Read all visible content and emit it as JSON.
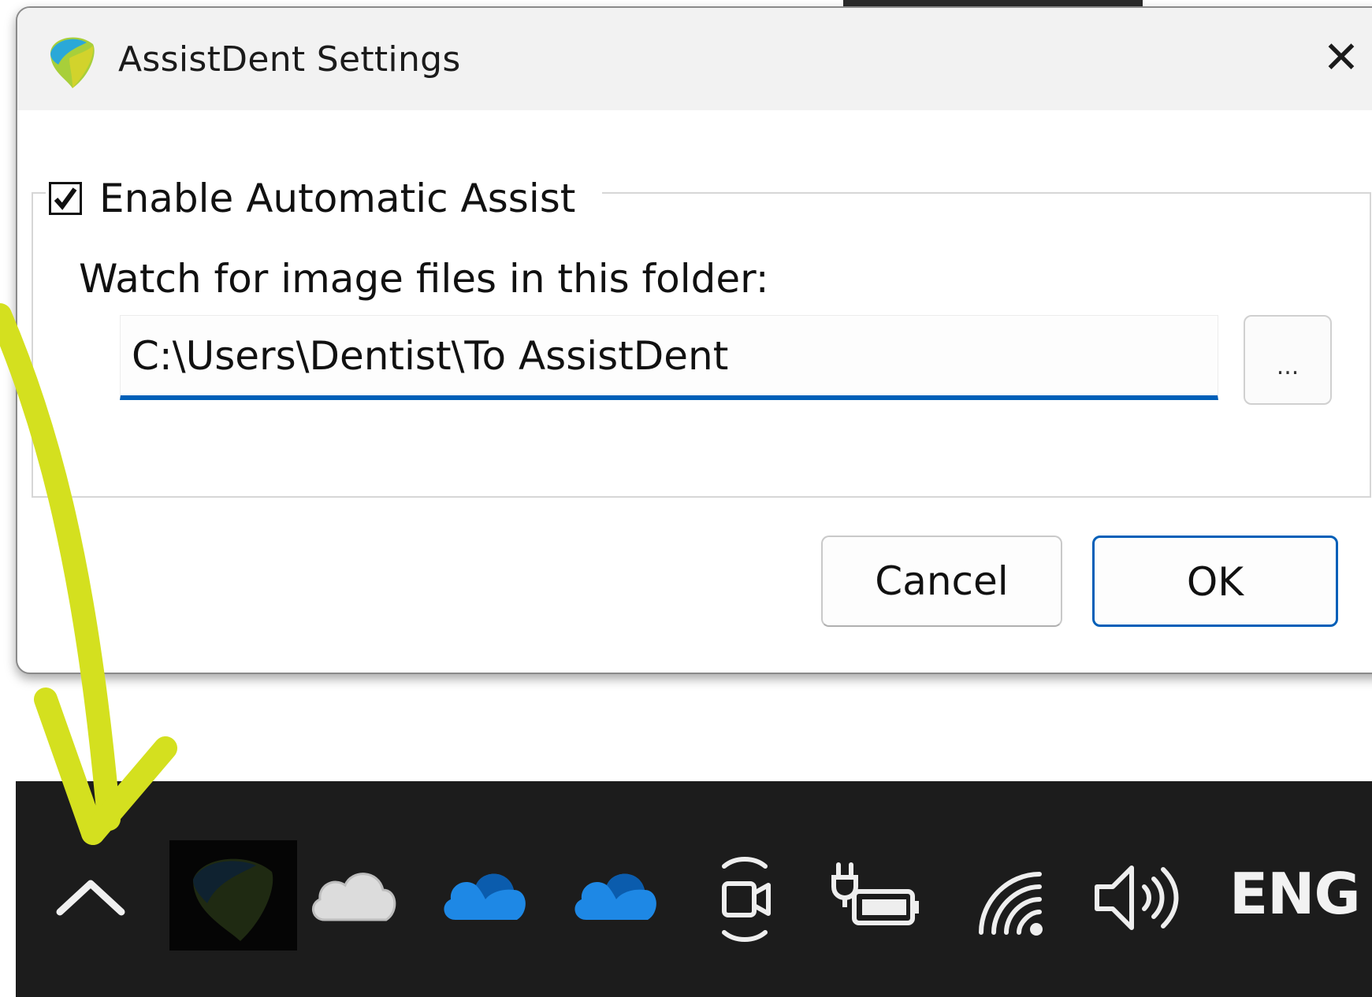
{
  "dialog": {
    "title": "AssistDent Settings",
    "close_glyph": "✕",
    "group": {
      "checkbox_label": "Enable Automatic Assist",
      "checkbox_checked": true,
      "watch_label": "Watch for image files in this folder:",
      "folder_value": "C:\\Users\\Dentist\\To AssistDent",
      "browse_label": "..."
    },
    "buttons": {
      "cancel": "Cancel",
      "ok": "OK"
    }
  },
  "taskbar": {
    "language": "ENG",
    "tray_icons": [
      "chevron-up-icon",
      "assistdent-tray-icon",
      "onedrive-grey-icon",
      "onedrive-blue-icon",
      "onedrive-blue-icon",
      "camera-presence-icon",
      "battery-charging-icon",
      "wifi-icon",
      "volume-icon"
    ]
  },
  "colors": {
    "accent": "#005fb8",
    "annotation_arrow": "#d4e01f",
    "taskbar_bg": "#1c1c1c",
    "onedrive_blue": "#1e88e5"
  }
}
